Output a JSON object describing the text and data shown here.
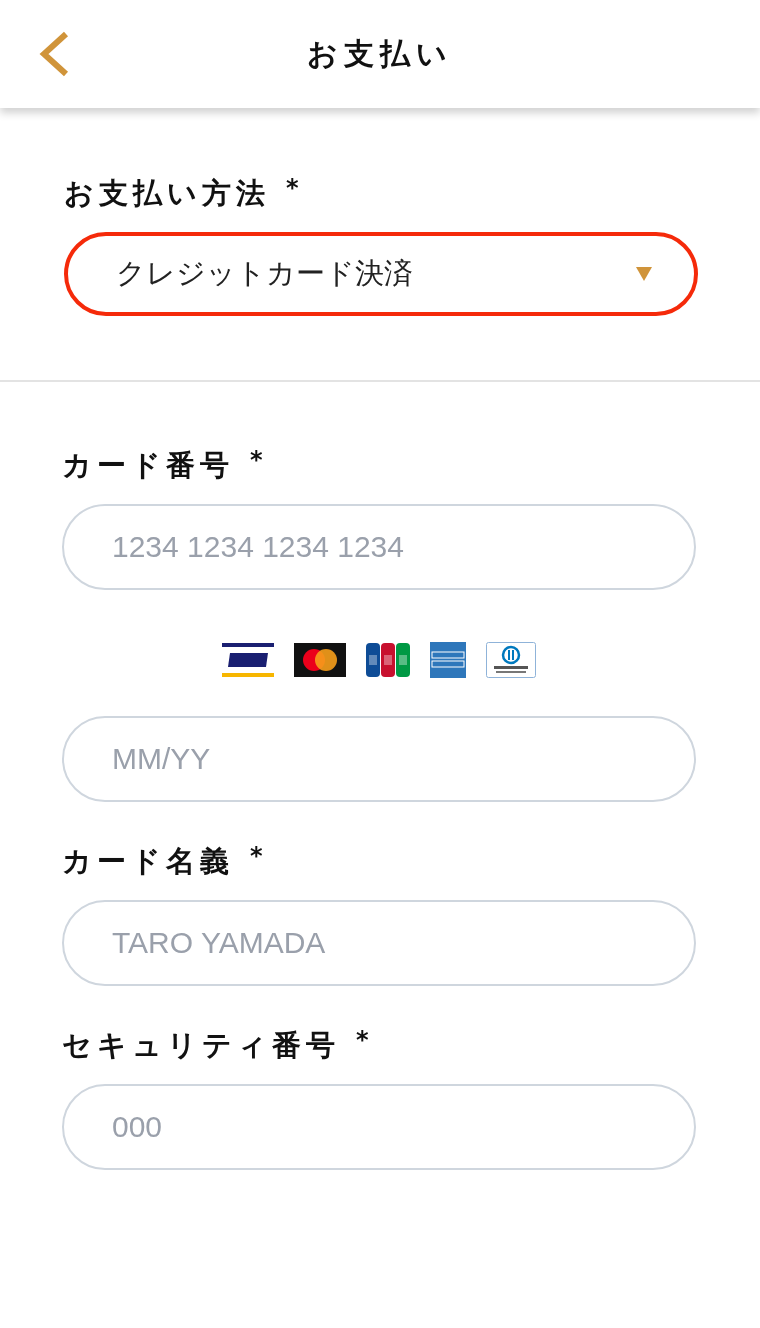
{
  "header": {
    "title": "お支払い"
  },
  "payment_method": {
    "label": "お支払い方法",
    "mark": "*",
    "value": "クレジットカード決済",
    "highlighted": true
  },
  "card_form": [
    {
      "kind": "field",
      "label": "カード番号",
      "mark": "*",
      "placeholder": "1234 1234 1234 1234"
    },
    {
      "kind": "brands"
    },
    {
      "kind": "field",
      "placeholder": "MM/YY"
    },
    {
      "kind": "field",
      "label": "カード名義",
      "mark": "*",
      "placeholder": "TARO YAMADA"
    },
    {
      "kind": "field",
      "label": "セキュリティ番号",
      "mark": "*",
      "placeholder": "000"
    }
  ]
}
